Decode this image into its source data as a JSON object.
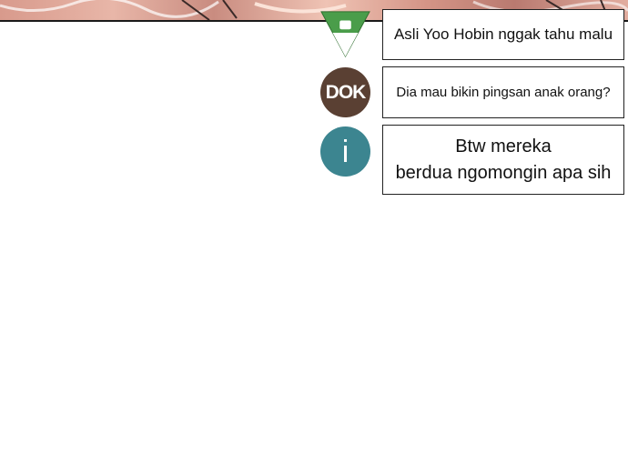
{
  "colors": {
    "avatar_green": "#4a9d4a",
    "avatar_brown": "#5a4033",
    "avatar_teal": "#3c8590"
  },
  "comments": [
    {
      "avatar_icon": "green-triangle-badge-icon",
      "text": "Asli Yoo Hobin nggak tahu malu"
    },
    {
      "avatar_icon": "dok-badge-icon",
      "avatar_label": "DOK",
      "text": "Dia mau bikin pingsan anak orang?"
    },
    {
      "avatar_icon": "info-icon",
      "avatar_label": "i",
      "text_lines": [
        "Btw mereka",
        "berdua ngomongin apa sih"
      ]
    }
  ]
}
